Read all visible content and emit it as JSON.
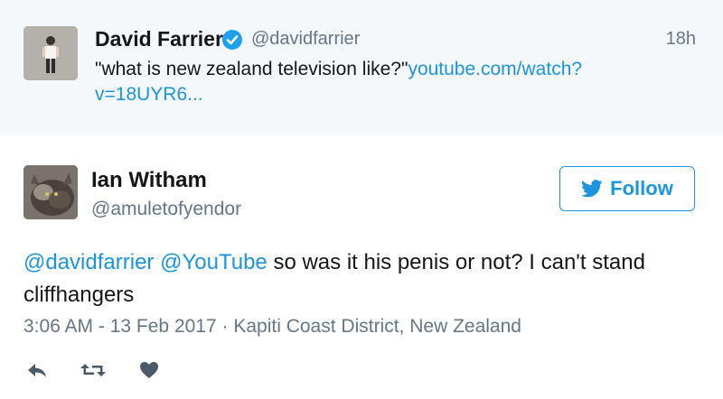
{
  "quoted_tweet": {
    "author_name": "David Farrier",
    "author_handle": "@davidfarrier",
    "time": "18h",
    "text": "\"what is new zealand television like?\"",
    "link_text": "youtube.com/watch?v=18UYR6..."
  },
  "tweet": {
    "author_name": "Ian Witham",
    "author_handle": "@amuletofyendor",
    "follow_label": "Follow",
    "mention_1": "@davidfarrier",
    "mention_2": "@YouTube",
    "text": "so was it his penis or not? I can't stand cliffhangers",
    "time": "3:06 AM",
    "date": "13 Feb 2017",
    "location": "Kapiti Coast District, New Zealand"
  },
  "colors": {
    "link_blue": "#1b95e0",
    "secondary_gray": "#657786",
    "action_gray": "#4b5a68",
    "quoted_background": "#f5f8fa"
  },
  "icons": [
    "verified-badge-icon",
    "twitter-bird-icon",
    "reply-icon",
    "retweet-icon",
    "like-heart-icon"
  ]
}
